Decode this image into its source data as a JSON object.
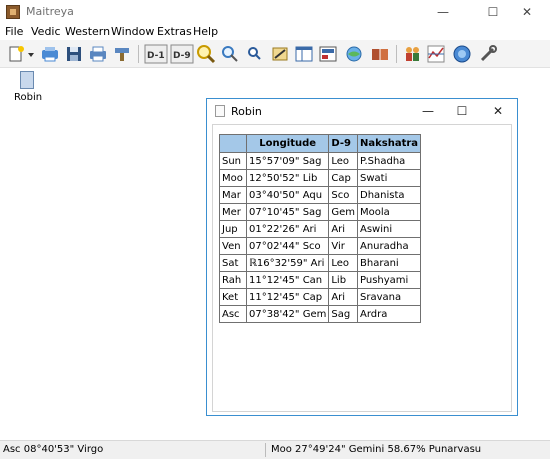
{
  "app": {
    "title": "Maitreya"
  },
  "window_controls": {
    "minimize": "—",
    "maximize": "☐",
    "close": "✕"
  },
  "menu": [
    "File",
    "Vedic",
    "Western",
    "Window",
    "Extras",
    "Help"
  ],
  "toolbar": {
    "d1_label": "D-1",
    "d9_label": "D-9",
    "icons": [
      "new-icon",
      "open-icon",
      "save-icon",
      "print-icon",
      "print-setup-icon",
      "d1-chart-icon",
      "d9-chart-icon",
      "zoom-in-icon",
      "zoom-icon",
      "search-icon",
      "edit-icon",
      "table-icon",
      "image-icon",
      "globe-pin-icon",
      "book-icon",
      "people-icon",
      "graph-icon",
      "planet-icon",
      "tools-icon"
    ]
  },
  "desktop": {
    "icon_label": "Robin"
  },
  "child_window": {
    "title": "Robin",
    "controls": {
      "minimize": "—",
      "maximize": "☐",
      "close": "✕"
    },
    "table": {
      "headers": [
        "",
        "Longitude",
        "D-9",
        "Nakshatra"
      ],
      "rows": [
        [
          "Sun",
          "15°57'09\" Sag",
          "Leo",
          "P.Shadha"
        ],
        [
          "Moo",
          "12°50'52\" Lib",
          "Cap",
          "Swati"
        ],
        [
          "Mar",
          "03°40'50\" Aqu",
          "Sco",
          "Dhanista"
        ],
        [
          "Mer",
          "07°10'45\" Sag",
          "Gem",
          "Moola"
        ],
        [
          "Jup",
          "01°22'26\" Ari",
          "Ari",
          "Aswini"
        ],
        [
          "Ven",
          "07°02'44\" Sco",
          "Vir",
          "Anuradha"
        ],
        [
          "Sat",
          "ℝ16°32'59\" Ari",
          "Leo",
          "Bharani"
        ],
        [
          "Rah",
          "11°12'45\" Can",
          "Lib",
          "Pushyami"
        ],
        [
          "Ket",
          "11°12'45\" Cap",
          "Ari",
          "Sravana"
        ],
        [
          "Asc",
          "07°38'42\" Gem",
          "Sag",
          "Ardra"
        ]
      ]
    }
  },
  "status": {
    "left": "Asc 08°40'53\" Virgo",
    "right": "Moo 27°49'24\" Gemini 58.67% Punarvasu"
  }
}
